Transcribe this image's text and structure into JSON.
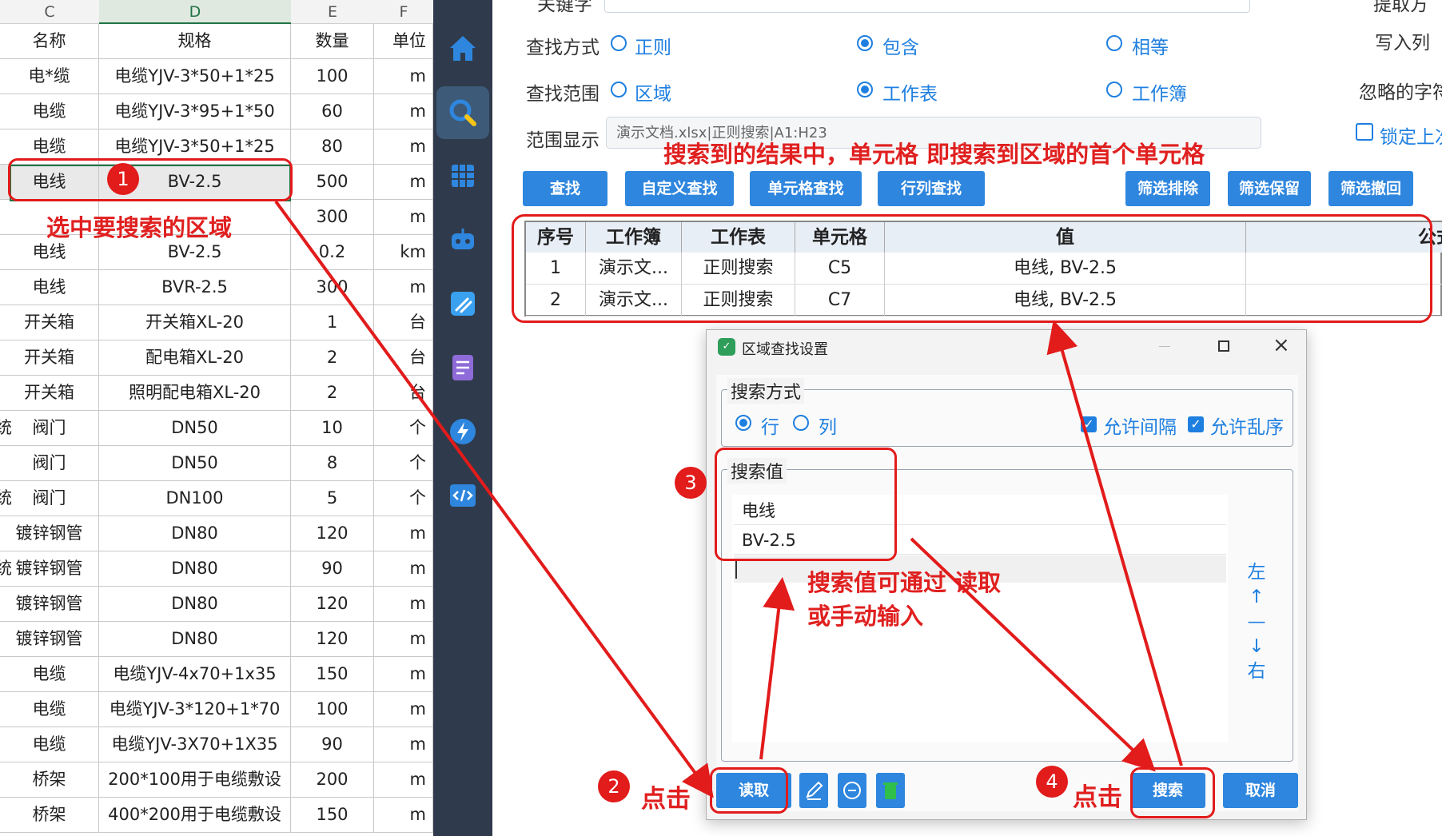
{
  "sheet": {
    "columns": [
      "C",
      "D",
      "E",
      "F"
    ],
    "header": [
      "名称",
      "规格",
      "数量",
      "单位"
    ],
    "rows": [
      {
        "pre": "",
        "c": "电*缆",
        "d": "电缆YJV-3*50+1*25",
        "e": "100",
        "f": "m"
      },
      {
        "pre": "",
        "c": "电缆",
        "d": "电缆YJV-3*95+1*50",
        "e": "60",
        "f": "m"
      },
      {
        "pre": "",
        "c": "电缆",
        "d": "电缆YJV-3*50+1*25",
        "e": "80",
        "f": "m"
      },
      {
        "pre": "",
        "c": "电线",
        "d": "BV-2.5",
        "e": "500",
        "f": "m"
      },
      {
        "pre": "",
        "c": "",
        "d": "",
        "e": "300",
        "f": "m"
      },
      {
        "pre": "",
        "c": "电线",
        "d": "BV-2.5",
        "e": "0.2",
        "f": "km"
      },
      {
        "pre": "",
        "c": "电线",
        "d": "BVR-2.5",
        "e": "300",
        "f": "m"
      },
      {
        "pre": "",
        "c": "开关箱",
        "d": "开关箱XL-20",
        "e": "1",
        "f": "台"
      },
      {
        "pre": "",
        "c": "开关箱",
        "d": "配电箱XL-20",
        "e": "2",
        "f": "台"
      },
      {
        "pre": "",
        "c": "开关箱",
        "d": "照明配电箱XL-20",
        "e": "2",
        "f": "台"
      },
      {
        "pre": "统",
        "c": "阀门",
        "d": "DN50",
        "e": "10",
        "f": "个"
      },
      {
        "pre": "",
        "c": "阀门",
        "d": "DN50",
        "e": "8",
        "f": "个"
      },
      {
        "pre": "统",
        "c": "阀门",
        "d": "DN100",
        "e": "5",
        "f": "个"
      },
      {
        "pre": "",
        "c": "镀锌钢管",
        "d": "DN80",
        "e": "120",
        "f": "m"
      },
      {
        "pre": "统",
        "c": "镀锌钢管",
        "d": "DN80",
        "e": "90",
        "f": "m"
      },
      {
        "pre": "",
        "c": "镀锌钢管",
        "d": "DN80",
        "e": "120",
        "f": "m"
      },
      {
        "pre": "",
        "c": "镀锌钢管",
        "d": "DN80",
        "e": "120",
        "f": "m"
      },
      {
        "pre": "",
        "c": "电缆",
        "d": "电缆YJV-4x70+1x35",
        "e": "150",
        "f": "m"
      },
      {
        "pre": "",
        "c": "电缆",
        "d": "电缆YJV-3*120+1*70",
        "e": "100",
        "f": "m"
      },
      {
        "pre": "",
        "c": "电缆",
        "d": "电缆YJV-3X70+1X35",
        "e": "90",
        "f": "m"
      },
      {
        "pre": "",
        "c": "桥架",
        "d": "200*100用于电缆敷设",
        "e": "200",
        "f": "m"
      },
      {
        "pre": "",
        "c": "桥架",
        "d": "400*200用于电缆敷设",
        "e": "150",
        "f": "m"
      }
    ]
  },
  "sidebar": {
    "icons": [
      "home-icon",
      "search-icon",
      "grid-icon",
      "robot-icon",
      "broom-icon",
      "notes-icon",
      "lightning-icon",
      "code-icon"
    ]
  },
  "main": {
    "keyword_label": "关键字",
    "search_mode_label": "查找方式",
    "search_mode_options": [
      "正则",
      "包含",
      "相等"
    ],
    "search_scope_label": "查找范围",
    "search_scope_options": [
      "区域",
      "工作表",
      "工作簿"
    ],
    "range_label": "范围显示",
    "range_value": "演示文档.xlsx|正则搜索|A1:H23",
    "right_labels": [
      "提取方",
      "写入列",
      "忽略的字符"
    ],
    "lock_label": "锁定上次",
    "buttons": [
      "查找",
      "自定义查找",
      "单元格查找",
      "行列查找",
      "筛选排除",
      "筛选保留",
      "筛选撤回"
    ],
    "table_headers": [
      "序号",
      "工作簿",
      "工作表",
      "单元格",
      "值",
      "公式"
    ],
    "table_rows": [
      {
        "idx": "1",
        "book": "演示文...",
        "sheet": "正则搜索",
        "cell": "C5",
        "value": "电线, BV-2.5"
      },
      {
        "idx": "2",
        "book": "演示文...",
        "sheet": "正则搜索",
        "cell": "C7",
        "value": "电线, BV-2.5"
      }
    ]
  },
  "dialog": {
    "title": "区域查找设置",
    "search_mode_group": "搜索方式",
    "row_label": "行",
    "col_label": "列",
    "allow_gap": "允许间隔",
    "allow_disorder": "允许乱序",
    "search_value_group": "搜索值",
    "values": [
      "电线",
      "BV-2.5"
    ],
    "side_chars": [
      "左",
      "↑",
      "—",
      "↓",
      "右"
    ],
    "read_button": "读取",
    "search_button": "搜索",
    "cancel_button": "取消"
  },
  "annotations": {
    "top_note": "搜索到的结果中，单元格 即搜索到区域的首个单元格",
    "select_note": "选中要搜索的区域",
    "value_note_1": "搜索值可通过 读取",
    "value_note_2": "或手动输入",
    "click_1": "点击",
    "click_2": "点击",
    "badges": [
      "1",
      "2",
      "3",
      "4"
    ]
  },
  "colors": {
    "accent": "#2e86de",
    "annotation": "#e21b1b",
    "sidebar": "#2f3b4c"
  }
}
